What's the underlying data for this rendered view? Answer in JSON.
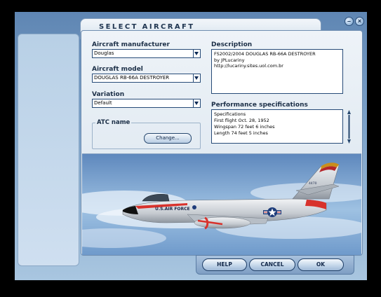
{
  "dialog": {
    "title": "SELECT AIRCRAFT"
  },
  "fields": {
    "manufacturer": {
      "label": "Aircraft manufacturer",
      "value": "Douglas"
    },
    "model": {
      "label": "Aircraft model",
      "value": "DOUGLAS RB-66A DESTROYER"
    },
    "variation": {
      "label": "Variation",
      "value": "Default"
    }
  },
  "atc": {
    "label": "ATC name",
    "change_label": "Change..."
  },
  "description": {
    "label": "Description",
    "lines": [
      "FS2002/2004 DOUGLAS RB-66A DESTROYER",
      "by JPLucariny",
      "http://lucariny.sites.uol.com.br"
    ]
  },
  "performance": {
    "label": "Performance specifications",
    "lines": [
      "Specifications",
      "First flight Oct. 28, 1952",
      "Wingspan 72 feet 6 inches",
      "Length 74 feet 5 inches"
    ]
  },
  "preview": {
    "fuselage_text": "U.S.AIR FORCE",
    "tail_code": "4470"
  },
  "buttons": {
    "help": "HELP",
    "cancel": "CANCEL",
    "ok": "OK"
  },
  "window_controls": {
    "minimize_icon": "minimize-icon",
    "close_icon": "close-icon"
  },
  "colors": {
    "panel_border": "#274b78",
    "accent_red": "#d8322c"
  }
}
